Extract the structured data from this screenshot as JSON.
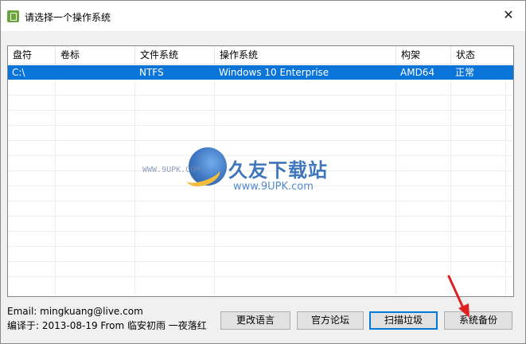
{
  "window": {
    "title": "请选择一个操作系统",
    "close_glyph": "✕"
  },
  "table": {
    "columns": [
      "盘符",
      "卷标",
      "文件系统",
      "操作系统",
      "构架",
      "状态"
    ],
    "rows": [
      {
        "drive": "C:\\",
        "label": "",
        "fs": "NTFS",
        "os": "Windows 10 Enterprise",
        "arch": "AMD64",
        "status": "正常"
      }
    ],
    "selected_color": "#0a74d8"
  },
  "watermark": {
    "title": "久友下载站",
    "url": "www.9UPK.com",
    "small": "WWW.9UPK.COM"
  },
  "footer": {
    "email": "Email: mingkuang@live.com",
    "compiled": "编译于: 2013-08-19 From 临安初雨 一夜落红"
  },
  "buttons": {
    "change_language": "更改语言",
    "forum": "官方论坛",
    "scan_junk": "扫描垃圾",
    "backup": "系统备份"
  },
  "annotation_arrow_color": "#e02020"
}
